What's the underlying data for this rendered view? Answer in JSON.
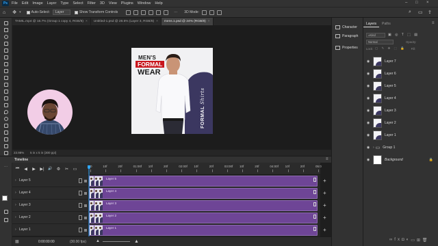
{
  "app": {
    "logo": "Ps"
  },
  "menu": [
    "File",
    "Edit",
    "Image",
    "Layer",
    "Type",
    "Select",
    "Filter",
    "3D",
    "View",
    "Plugins",
    "Window",
    "Help"
  ],
  "window_controls": [
    "–",
    "□",
    "×"
  ],
  "options": {
    "auto_select_label": "Auto-Select:",
    "auto_select_value": "Layer",
    "transform_label": "Show Transform Controls",
    "more": "···",
    "three_d": "3D Mode:"
  },
  "doc_tabs": [
    {
      "label": "TAMIL.mp4 @ 16.7% (Group 1 copy 4, RGB/8)",
      "close": "×"
    },
    {
      "label": "Untitled-1.psd @ 28.5% (Layer 3, RGB/8)",
      "close": "×"
    },
    {
      "label": "mens.1.psd @ 24% (RGB/8)",
      "close": "×"
    }
  ],
  "artwork": {
    "line1": "MEN'S",
    "line2": "FORMAL",
    "line3": "WEAR",
    "side": "FORMAL",
    "side2": "Shirts"
  },
  "status": {
    "zoom": "23.98%",
    "size": "5 in x 5 in (300 ppi)"
  },
  "timeline": {
    "title": "Timeline",
    "controls": [
      "⏮",
      "◀",
      "▶",
      "▶|",
      "🔊",
      "⚙",
      "✂",
      "▭"
    ],
    "ruler": [
      "0",
      "10f",
      "20f",
      "01:00f",
      "10f",
      "20f",
      "02:00f",
      "10f",
      "20f",
      "03:00f",
      "10f",
      "20f",
      "04:00f",
      "10f",
      "20f",
      "05:0"
    ],
    "tracks": [
      {
        "name": "Layer 5",
        "clip": "Layer 5"
      },
      {
        "name": "Layer 4",
        "clip": "Layer 4"
      },
      {
        "name": "Layer 3",
        "clip": "Layer 3"
      },
      {
        "name": "Layer 2",
        "clip": "Layer 2"
      },
      {
        "name": "Layer 1",
        "clip": "Layer 1"
      }
    ],
    "timecode": "0:00:00:00",
    "fps": "(30.00 fps)"
  },
  "mid_panel": [
    {
      "label": "Character"
    },
    {
      "label": "Paragraph"
    },
    {
      "label": "Properties"
    }
  ],
  "layers_panel": {
    "tabs": [
      "Layers",
      "Paths"
    ],
    "filter": "Kind",
    "blend": "Normal",
    "opacity_label": "Opacity:",
    "lock_label": "Lock:",
    "fill_label": "Fill:",
    "layers": [
      {
        "name": "Layer 7",
        "thumb": "photo"
      },
      {
        "name": "Layer 6",
        "thumb": "photo"
      },
      {
        "name": "Layer 5",
        "thumb": "photo"
      },
      {
        "name": "Layer 4",
        "thumb": "photo"
      },
      {
        "name": "Layer 3",
        "thumb": "photo"
      },
      {
        "name": "Layer 2",
        "thumb": "photo"
      },
      {
        "name": "Layer 1",
        "thumb": "photo"
      },
      {
        "name": "Group 1",
        "thumb": "folder"
      },
      {
        "name": "Background",
        "thumb": "white"
      }
    ]
  },
  "colors": {
    "clip": "#6e4596",
    "accent": "#31a8ff",
    "art_red": "#c8161d",
    "art_navy": "#3b3760"
  }
}
